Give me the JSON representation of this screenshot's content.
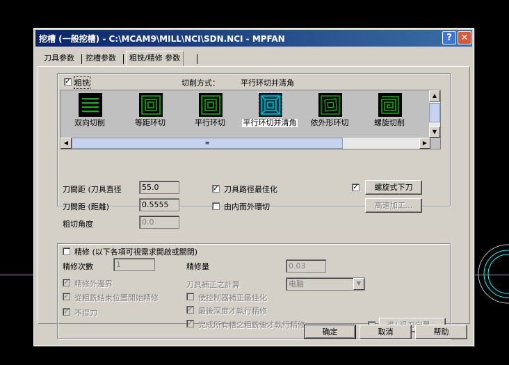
{
  "window": {
    "title": "挖槽 (一般挖槽) - C:\\MCAM9\\MILL\\NCI\\SDN.NCI - MPFAN",
    "help_label": "?",
    "close_label": "✕"
  },
  "tabs": [
    {
      "label": "刀具参数"
    },
    {
      "label": "挖槽参数"
    },
    {
      "label": "粗铣/精修 参数"
    }
  ],
  "rough": {
    "checkbox_label": "粗铣",
    "checked": true,
    "cut_method_label": "切削方式：",
    "cut_method_value": "平行环切并清角",
    "options": [
      {
        "label": "双向切削",
        "icon": "zigzag-icon"
      },
      {
        "label": "等距环切",
        "icon": "constant-overlap-spiral-icon"
      },
      {
        "label": "平行环切",
        "icon": "parallel-spiral-icon"
      },
      {
        "label": "平行环切并清角",
        "icon": "parallel-spiral-clean-corners-icon"
      },
      {
        "label": "依外形环切",
        "icon": "morph-spiral-icon"
      },
      {
        "label": "螺旋切削",
        "icon": "true-spiral-icon"
      }
    ],
    "stepover_diameter_label": "刀間距 (刀具直徑",
    "stepover_diameter_value": "55.0",
    "stepover_distance_label": "刀間距 (距離)",
    "stepover_distance_value": "0.5555",
    "rough_angle_label": "粗切角度",
    "rough_angle_value": "0.0",
    "minimize_label": "刀具路徑最佳化",
    "minimize_checked": true,
    "inside_out_label": "由内而外環切",
    "inside_out_checked": false,
    "helix_checked": true,
    "helix_label": "螺旋式下刀",
    "high_speed_label": "高速加工..."
  },
  "finish": {
    "checkbox_label": "精修 (以下各項可視需求開啟或關閉)",
    "checked": false,
    "passes_label": "精修次數",
    "passes_value": "1",
    "stock_label": "精修量",
    "stock_value": "0.03",
    "outer_boundary_label": "精修外邊界",
    "from_rough_end_label": "從粗銑結束位置開始精修",
    "no_lift_label": "不提刀",
    "cutter_comp_label": "刀具補正之計算",
    "cutter_comp_value": "电脑",
    "optimize_control_label": "使控制器補正最佳化",
    "final_depth_label": "最後深度才執行精修",
    "after_all_label": "完成所有槽之粗銑後才執行精修",
    "lead_label": "進/ 退刀向量..."
  },
  "buttons": {
    "ok": "确定",
    "cancel": "取消",
    "help": "帮助"
  },
  "colors": {
    "title_start": "#0a246a",
    "title_end": "#3a6ea5",
    "face": "#d4d0c8",
    "icon_green": "#00c000",
    "icon_cyan": "#00c0c0",
    "background_line": "#c8a000"
  }
}
